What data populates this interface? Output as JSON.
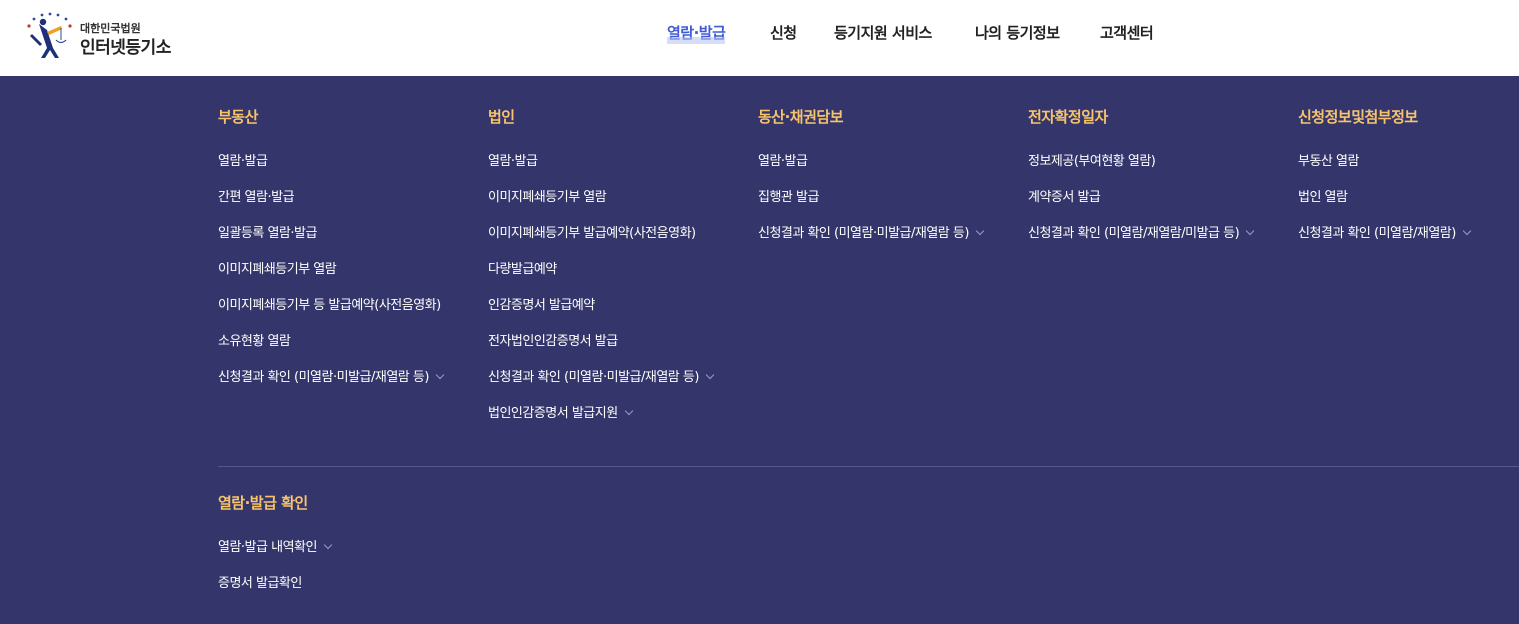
{
  "logo": {
    "org": "대한민국법원",
    "name": "인터넷등기소"
  },
  "gnb": {
    "items": [
      {
        "label": "열람·발급",
        "active": true
      },
      {
        "label": "신청",
        "active": false
      },
      {
        "label": "등기지원 서비스",
        "active": false
      },
      {
        "label": "나의 등기정보",
        "active": false
      },
      {
        "label": "고객센터",
        "active": false
      }
    ]
  },
  "mega": {
    "columns": [
      {
        "title": "부동산",
        "items": [
          {
            "label": "열람·발급",
            "expandable": false
          },
          {
            "label": "간편 열람·발급",
            "expandable": false
          },
          {
            "label": "일괄등록 열람·발급",
            "expandable": false
          },
          {
            "label": "이미지폐쇄등기부 열람",
            "expandable": false
          },
          {
            "label": "이미지폐쇄등기부 등 발급예약(사전음영화)",
            "expandable": false
          },
          {
            "label": "소유현황 열람",
            "expandable": false
          },
          {
            "label": "신청결과 확인 (미열람·미발급/재열람 등)",
            "expandable": true
          }
        ]
      },
      {
        "title": "법인",
        "items": [
          {
            "label": "열람·발급",
            "expandable": false
          },
          {
            "label": "이미지폐쇄등기부 열람",
            "expandable": false
          },
          {
            "label": "이미지폐쇄등기부 발급예약(사전음영화)",
            "expandable": false
          },
          {
            "label": "다량발급예약",
            "expandable": false
          },
          {
            "label": "인감증명서 발급예약",
            "expandable": false
          },
          {
            "label": "전자법인인감증명서 발급",
            "expandable": false
          },
          {
            "label": "신청결과 확인 (미열람·미발급/재열람 등)",
            "expandable": true
          },
          {
            "label": "법인인감증명서 발급지원",
            "expandable": true
          }
        ]
      },
      {
        "title": "동산·채권담보",
        "items": [
          {
            "label": "열람·발급",
            "expandable": false
          },
          {
            "label": "집행관 발급",
            "expandable": false
          },
          {
            "label": "신청결과 확인 (미열람·미발급/재열람 등)",
            "expandable": true
          }
        ]
      },
      {
        "title": "전자확정일자",
        "items": [
          {
            "label": "정보제공(부여현황 열람)",
            "expandable": false
          },
          {
            "label": "계약증서 발급",
            "expandable": false
          },
          {
            "label": "신청결과 확인 (미열람/재열람/미발급 등)",
            "expandable": true
          }
        ]
      },
      {
        "title": "신청정보및첨부정보",
        "items": [
          {
            "label": "부동산 열람",
            "expandable": false
          },
          {
            "label": "법인 열람",
            "expandable": false
          },
          {
            "label": "신청결과 확인 (미열람/재열람)",
            "expandable": true
          }
        ]
      }
    ],
    "confirm": {
      "title": "열람·발급 확인",
      "items": [
        {
          "label": "열람·발급 내역확인",
          "expandable": true
        },
        {
          "label": "증명서 발급확인",
          "expandable": false
        }
      ]
    }
  },
  "colors": {
    "menu_bg": "#34366b",
    "heading": "#f7c36b",
    "active_nav": "#3f5bd6"
  }
}
